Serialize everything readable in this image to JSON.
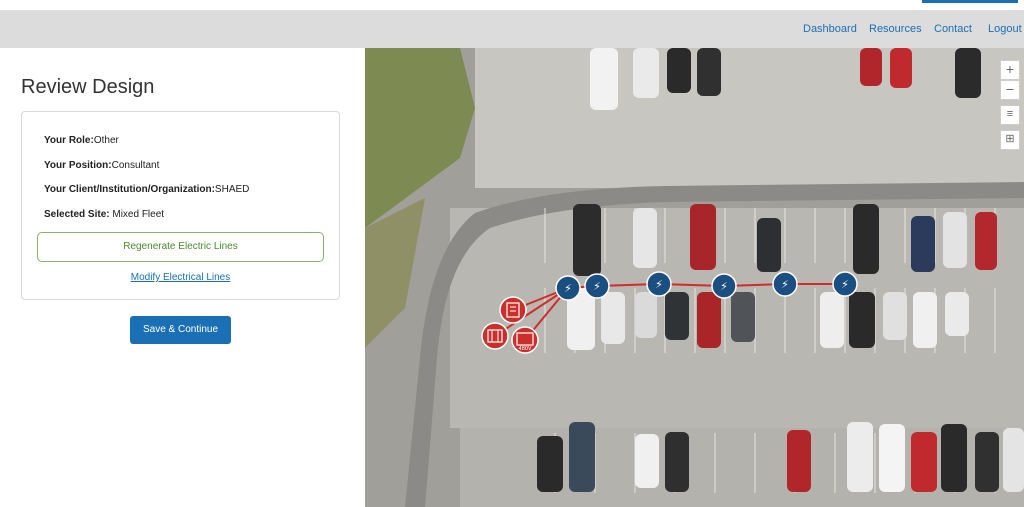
{
  "nav": {
    "links": [
      "Dashboard",
      "Resources",
      "Contact",
      "Logout"
    ]
  },
  "page": {
    "title": "Review Design"
  },
  "card": {
    "role_label": "Your Role:",
    "role_value": "Other",
    "position_label": "Your Position:",
    "position_value": "Consultant",
    "org_label": "Your Client/Institution/Organization:",
    "org_value": "SHAED",
    "site_label": "Selected Site:",
    "site_value": " Mixed Fleet",
    "regenerate_label": "Regenerate Electric Lines",
    "modify_label": "Modify Electrical Lines"
  },
  "actions": {
    "save_label": "Save & Continue"
  },
  "map": {
    "controls": [
      "+",
      "−",
      "≡",
      "⊞"
    ],
    "charger_count": 6,
    "equipment_count": 3,
    "equipment_labels": [
      "",
      "",
      "480V"
    ],
    "line_color": "#d42a2a",
    "charger_color": "#1b4f82",
    "equipment_color": "#c9302c"
  },
  "colors": {
    "accent": "#1b6fb5",
    "navbar_bg": "#dcdcdc",
    "regen_border": "#8ab26a"
  }
}
